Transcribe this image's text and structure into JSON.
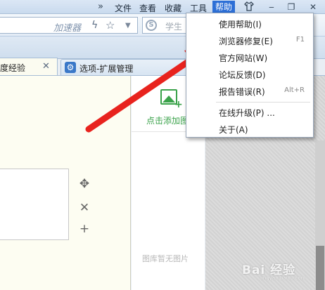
{
  "menubar": {
    "overflow": "»",
    "items": [
      "文件",
      "查看",
      "收藏",
      "工具",
      "帮助"
    ],
    "active": "帮助",
    "skin_icon": "shirt-icon",
    "window_buttons": {
      "minimize": "‒",
      "restore": "❐",
      "close": "✕"
    }
  },
  "toolbar": {
    "accelerator": "加速器",
    "search_placeholder": "学生"
  },
  "tabs": [
    {
      "label": "度经验",
      "close": "✕"
    },
    {
      "label": "选项-扩展管理",
      "icon": "gear-icon"
    }
  ],
  "content": {
    "add_image_label": "点击添加图",
    "empty_gallery": "图库暂无图片",
    "controls": [
      "✥",
      "✕",
      "+"
    ]
  },
  "help_menu": {
    "items": [
      {
        "label": "使用帮助(I)",
        "shortcut": ""
      },
      {
        "label": "浏览器修复(E)",
        "shortcut": "F1"
      },
      {
        "label": "官方网站(W)",
        "shortcut": ""
      },
      {
        "label": "论坛反馈(D)",
        "shortcut": ""
      },
      {
        "label": "报告错误(R)",
        "shortcut": "Alt+R"
      },
      {
        "label": "在线升级(P) ...",
        "shortcut": ""
      },
      {
        "label": "关于(A)",
        "shortcut": ""
      }
    ]
  },
  "watermark": {
    "brand": "Bai 经验",
    "sub": "jingyan.baidu.com"
  },
  "colors": {
    "arrow": "#e8231e",
    "menu_active": "#2d6fd6",
    "add_green": "#3aa24a"
  }
}
